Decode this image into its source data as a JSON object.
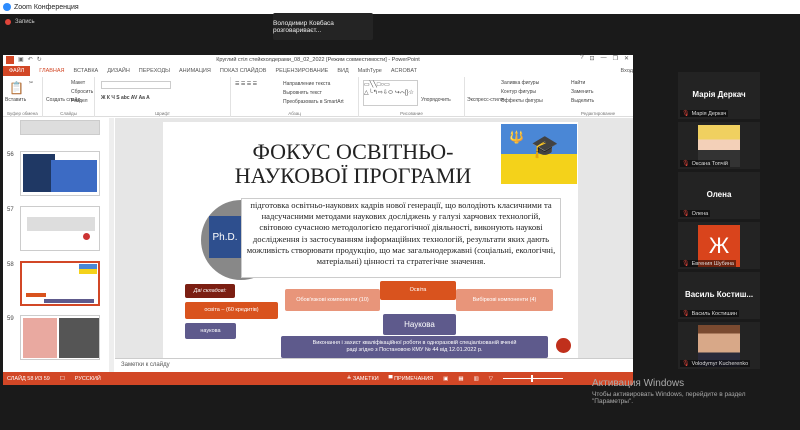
{
  "zoom": {
    "window_title": "Zoom Конференция",
    "recording": "Запись",
    "speaker_banner": "Володимир Ковбаса розговариваєт..."
  },
  "powerpoint": {
    "title": "Круглий стіл стейкхолдерами_08_02_2022 [Режим совместимости] - PowerPoint",
    "window_controls": [
      "?",
      "⊡",
      "—",
      "❐",
      "✕"
    ],
    "tabs": [
      "ФАЙЛ",
      "ГЛАВНАЯ",
      "ВСТАВКА",
      "ДИЗАЙН",
      "ПЕРЕХОДЫ",
      "АНИМАЦИЯ",
      "ПОКАЗ СЛАЙДОВ",
      "РЕЦЕНЗИРОВАНИЕ",
      "ВИД",
      "MathType",
      "ACROBAT"
    ],
    "signin": "Вход",
    "ribbon": {
      "paste": "Вставить",
      "new_slide": "Создать слайд",
      "layout": "Макет",
      "reset": "Сбросить",
      "section": "Раздел",
      "text_direction": "Направление текста",
      "align_text": "Выровнять текст",
      "smartart": "Преобразовать в SmartArt",
      "arrange": "Упорядочить",
      "quick_styles": "Экспресс-стили",
      "shape_fill": "Заливка фигуры",
      "shape_outline": "Контур фигуры",
      "shape_effects": "Эффекты фигуры",
      "find": "Найти",
      "replace": "Заменить",
      "select": "Выделить",
      "groups": [
        "Буфер обмена",
        "Слайды",
        "Шрифт",
        "Абзац",
        "Рисование",
        "Редактирование"
      ]
    },
    "thumbnails": [
      {
        "num": "56"
      },
      {
        "num": "57"
      },
      {
        "num": "58",
        "selected": true
      },
      {
        "num": "59"
      }
    ],
    "slide": {
      "title": "ФОКУС ОСВІТНЬО-НАУКОВОЇ ПРОГРАМИ",
      "phd": "Ph.D.",
      "body": "підготовка освітньо-наукових кадрів нової генерації, що володіють класичними та надсучасними методами наукових досліджень у галузі харчових технологій, світовою сучасною методологією педагогічної діяльності, виконують наукові дослідження із застосуванням інформаційних технологій, результати яких дають можливість створювати продукцію, що має загальнодержавні (соціальні, екологічні, матеріальні) цінності та стратегічне значення.",
      "components_label": "Дві складові:",
      "education_credits": "освіта – (60 кредитів)",
      "science": "наукова",
      "mandatory": "Обов'язкові компоненти (10)",
      "education": "Освіта",
      "elective": "Вибіркові компоненти (4)",
      "scientific": "Наукова",
      "thesis": "Виконання і захист кваліфікаційної роботи в одноразовій спеціалізованій вченій раді згідно з Постановою КМУ № 44 від 12.01.2022 р."
    },
    "notes_placeholder": "Заметки к слайду",
    "status": {
      "slide_of": "СЛАЙД 58 ИЗ 59",
      "language": "РУССКИЙ",
      "notes": "ЗАМЕТКИ",
      "comments": "ПРИМЕЧАНИЯ"
    },
    "colors": {
      "accent": "#d24726",
      "dark_red": "#7b1e12",
      "orange": "#d9531e",
      "salmon": "#e8957a",
      "purple": "#5e5a8c"
    }
  },
  "participants": [
    {
      "display": "Марія Деркач",
      "name": "Марія Деркач",
      "type": "text"
    },
    {
      "name": "Оксана Топчій",
      "type": "photo"
    },
    {
      "display": "Олена",
      "name": "Олена",
      "type": "text"
    },
    {
      "display": "Ж",
      "name": "Евгения Шубина",
      "type": "avatar"
    },
    {
      "display": "Василь  Костиш...",
      "name": "Василь Костишин",
      "type": "text"
    },
    {
      "name": "Volodymyr Kucherenko",
      "type": "photo"
    }
  ],
  "windows_activation": {
    "title": "Активация Windows",
    "text": "Чтобы активировать Windows, перейдите в раздел \"Параметры\"."
  }
}
